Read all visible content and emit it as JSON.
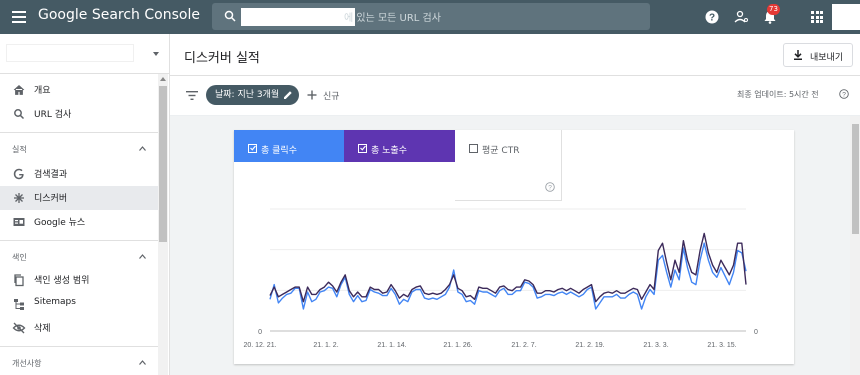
{
  "topbar": {
    "brand": "Google Search Console",
    "search_placeholder": "에 있는 모든 URL 검사",
    "notification_count": "73"
  },
  "sidebar": {
    "items_top": [
      {
        "label": "개요",
        "icon": "home-icon"
      },
      {
        "label": "URL 검사",
        "icon": "search-icon"
      }
    ],
    "section_performance": "실적",
    "items_performance": [
      {
        "label": "검색결과",
        "icon": "google-g-icon"
      },
      {
        "label": "디스커버",
        "icon": "asterisk-icon"
      },
      {
        "label": "Google 뉴스",
        "icon": "news-icon"
      }
    ],
    "section_index": "색인",
    "items_index": [
      {
        "label": "색인 생성 범위",
        "icon": "copy-icon"
      },
      {
        "label": "Sitemaps",
        "icon": "sitemap-icon"
      },
      {
        "label": "삭제",
        "icon": "eye-off-icon"
      }
    ],
    "section_enhancements": "개선사항"
  },
  "header": {
    "title": "디스커버 실적",
    "export_label": "내보내기"
  },
  "filters": {
    "date_chip": "날짜: 지난 3개월",
    "new_label": "신규",
    "last_updated": "최종 업데이트: 5시간 전"
  },
  "metrics": [
    {
      "label": "총 클릭수",
      "checked": true,
      "color": "#4285f4"
    },
    {
      "label": "총 노출수",
      "checked": true,
      "color": "#5e35b1"
    },
    {
      "label": "평균 CTR",
      "checked": false,
      "color": "#ffffff"
    }
  ],
  "chart_data": {
    "type": "line",
    "x": [
      "20. 12. 21.",
      "21. 1. 2.",
      "21. 1. 14.",
      "21. 1. 26.",
      "21. 2. 7.",
      "21. 2. 19.",
      "21. 3. 3.",
      "21. 3. 15."
    ],
    "y_left_min_label": "0",
    "y_right_min_label": "0",
    "series": [
      {
        "color": "#4285f4",
        "values": [
          26,
          38,
          23,
          27,
          30,
          31,
          35,
          35,
          18,
          32,
          24,
          26,
          32,
          33,
          36,
          35,
          28,
          38,
          44,
          30,
          24,
          29,
          24,
          25,
          34,
          32,
          31,
          29,
          29,
          35,
          30,
          22,
          26,
          24,
          32,
          34,
          34,
          27,
          26,
          27,
          26,
          28,
          30,
          36,
          50,
          32,
          30,
          24,
          25,
          22,
          33,
          32,
          32,
          30,
          28,
          33,
          35,
          30,
          30,
          33,
          33,
          40,
          39,
          36,
          27,
          28,
          30,
          30,
          29,
          31,
          32,
          30,
          32,
          30,
          28,
          30,
          34,
          36,
          18,
          23,
          28,
          28,
          28,
          30,
          27,
          27,
          30,
          32,
          30,
          18,
          28,
          34,
          30,
          58,
          62,
          48,
          36,
          50,
          42,
          68,
          52,
          40,
          38,
          58,
          72,
          58,
          48,
          44,
          52,
          45,
          38,
          48,
          66,
          64,
          49
        ]
      },
      {
        "color": "#3c2a5a",
        "values": [
          29,
          36,
          28,
          30,
          32,
          34,
          36,
          36,
          24,
          36,
          30,
          30,
          34,
          36,
          40,
          37,
          32,
          40,
          46,
          33,
          28,
          32,
          28,
          28,
          36,
          34,
          34,
          31,
          32,
          38,
          33,
          27,
          30,
          28,
          34,
          36,
          37,
          31,
          30,
          31,
          30,
          31,
          34,
          38,
          46,
          35,
          33,
          28,
          29,
          26,
          36,
          35,
          35,
          33,
          31,
          36,
          37,
          34,
          33,
          36,
          36,
          42,
          41,
          38,
          31,
          31,
          33,
          33,
          32,
          34,
          35,
          33,
          35,
          33,
          31,
          34,
          36,
          38,
          24,
          28,
          31,
          32,
          31,
          33,
          31,
          31,
          33,
          35,
          34,
          26,
          32,
          38,
          34,
          66,
          72,
          56,
          42,
          58,
          48,
          74,
          58,
          48,
          46,
          66,
          80,
          64,
          54,
          48,
          58,
          52,
          46,
          54,
          72,
          72,
          38
        ]
      }
    ],
    "grid": true
  }
}
